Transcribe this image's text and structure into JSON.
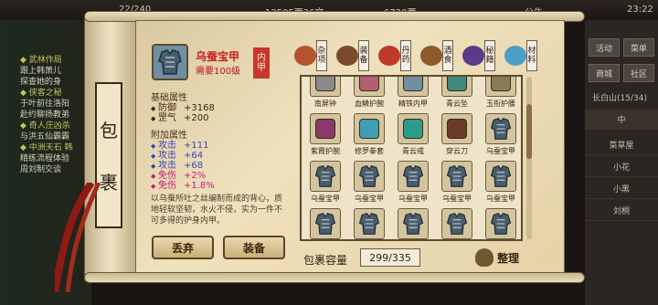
{
  "hud": {
    "top_values": [
      "22/240",
      "13505两36文",
      "6720两"
    ],
    "announcement": "公告",
    "time": "23:22",
    "right_buttons": [
      "活动",
      "菜单",
      "商城",
      "社区"
    ],
    "right_label": "长白山",
    "right_label_count": "(15/34)",
    "right_tab": "中",
    "right_rows": [
      "菜草屋",
      "小花",
      "小黑",
      "刘桐"
    ]
  },
  "left_log": [
    {
      "type": "hdr",
      "text": "◆ 武林作局"
    },
    {
      "type": "txt",
      "text": "跟上韩萧儿"
    },
    {
      "type": "txt",
      "text": "探查她的身"
    },
    {
      "type": "hdr",
      "text": "◆ 侠客之秘"
    },
    {
      "type": "txt",
      "text": "于叶前往洛阳"
    },
    {
      "type": "txt",
      "text": "赴约聊扬教弟"
    },
    {
      "type": "hdr",
      "text": "◆ 奇人庄凶杀"
    },
    {
      "type": "txt",
      "text": "与洪五仙霸霸"
    },
    {
      "type": "hdr",
      "text": "◆ 中洲天石 韩"
    },
    {
      "type": "txt",
      "text": "精练流程体验"
    },
    {
      "type": "txt",
      "text": "周刘制交谈"
    }
  ],
  "panel": {
    "title": "包裹",
    "title_chars": [
      "包",
      "裹"
    ],
    "item": {
      "name": "乌蚕宝甲",
      "requirement": "需要100级",
      "seal": [
        "内",
        "甲"
      ],
      "icon": "armor-icon"
    },
    "basic_title": "基础属性",
    "basic": [
      {
        "k": "防御",
        "v": "+3168"
      },
      {
        "k": "罡气",
        "v": "+200"
      }
    ],
    "extra_title": "附加属性",
    "extra": [
      {
        "k": "攻击",
        "v": "+111",
        "cls": "plus"
      },
      {
        "k": "攻击",
        "v": "+64",
        "cls": "plus"
      },
      {
        "k": "攻击",
        "v": "+68",
        "cls": "plus"
      },
      {
        "k": "免伤",
        "v": "+2%",
        "cls": "pink"
      },
      {
        "k": "免伤",
        "v": "+1.8%",
        "cls": "pink"
      }
    ],
    "description": "以乌蚕所吐之丝编制而成的背心，质地轻软坚韧，水火不侵，实为一件不可多得的护身内甲。",
    "discard_label": "丢弃",
    "equip_label": "装备"
  },
  "tabs": [
    {
      "label": "杂项",
      "color": "#b5532f"
    },
    {
      "label": "装备",
      "color": "#7a4a2a"
    },
    {
      "label": "丹药",
      "color": "#c0392b"
    },
    {
      "label": "酒食",
      "color": "#8c5a2b"
    },
    {
      "label": "秘籍",
      "color": "#5a3a8a"
    },
    {
      "label": "材料",
      "color": "#4a9fc4"
    }
  ],
  "grid": [
    {
      "name": "南屏钟",
      "color": "#8a8a8a"
    },
    {
      "name": "血鳞护腕",
      "color": "#b06070"
    },
    {
      "name": "精铁内甲",
      "color": "#6f8fa3"
    },
    {
      "name": "青云坠",
      "color": "#3d8a7d"
    },
    {
      "name": "玉衔护腰",
      "color": "#8a7a5a"
    },
    {
      "name": "紫霞护腕",
      "color": "#8a3a6a"
    },
    {
      "name": "修罗拳套",
      "color": "#3d9fb0"
    },
    {
      "name": "青云戒",
      "color": "#2c9c8a"
    },
    {
      "name": "穿云刀",
      "color": "#6d3b2a"
    },
    {
      "name": "乌蚕宝甲",
      "color": "#6f8fa3"
    },
    {
      "name": "乌蚕宝甲",
      "color": "#6f8fa3"
    },
    {
      "name": "乌蚕宝甲",
      "color": "#6f8fa3"
    },
    {
      "name": "乌蚕宝甲",
      "color": "#6f8fa3"
    },
    {
      "name": "乌蚕宝甲",
      "color": "#6f8fa3"
    },
    {
      "name": "乌蚕宝甲",
      "color": "#6f8fa3"
    },
    {
      "name": "乌蚕宝甲",
      "color": "#6f8fa3"
    },
    {
      "name": "乌蚕宝甲",
      "color": "#6f8fa3"
    },
    {
      "name": "乌蚕宝甲",
      "color": "#6f8fa3"
    },
    {
      "name": "乌蚕宝甲",
      "color": "#6f8fa3",
      "checked": true
    },
    {
      "name": "乌蚕宝甲",
      "color": "#6f8fa3"
    }
  ],
  "capacity_label": "包裹容量",
  "capacity_value": "299/335",
  "sort_label": "整理"
}
